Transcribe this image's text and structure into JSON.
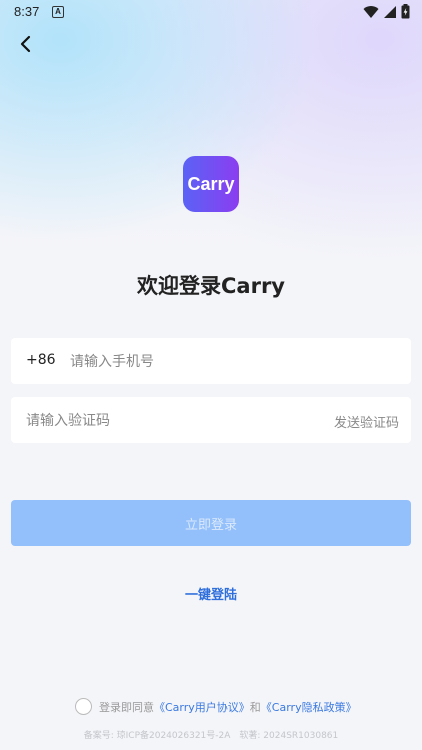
{
  "status_bar": {
    "time": "8:37",
    "notification_glyph": "A",
    "icons": [
      "wifi-icon",
      "signal-icon",
      "battery-icon"
    ]
  },
  "header": {
    "back_icon": "chevron-left-icon"
  },
  "logo": {
    "text": "Carry",
    "gradient": [
      "#5a63f5",
      "#8b3df0"
    ]
  },
  "title": "欢迎登录Carry",
  "phone_field": {
    "prefix": "+86",
    "placeholder": "请输入手机号",
    "value": ""
  },
  "code_field": {
    "placeholder": "请输入验证码",
    "value": "",
    "send_label": "发送验证码"
  },
  "login_button": {
    "label": "立即登录",
    "color": "#93c0fb"
  },
  "one_key_login": {
    "label": "一键登陆",
    "color": "#2f6fdc"
  },
  "agreement": {
    "prefix": "登录即同意",
    "user_agreement": "《Carry用户协议》",
    "and": "和",
    "privacy_policy": "《Carry隐私政策》",
    "checked": false
  },
  "record_info": "备案号: 琼ICP备2024026321号-2A　软著: 2024SR1030861"
}
